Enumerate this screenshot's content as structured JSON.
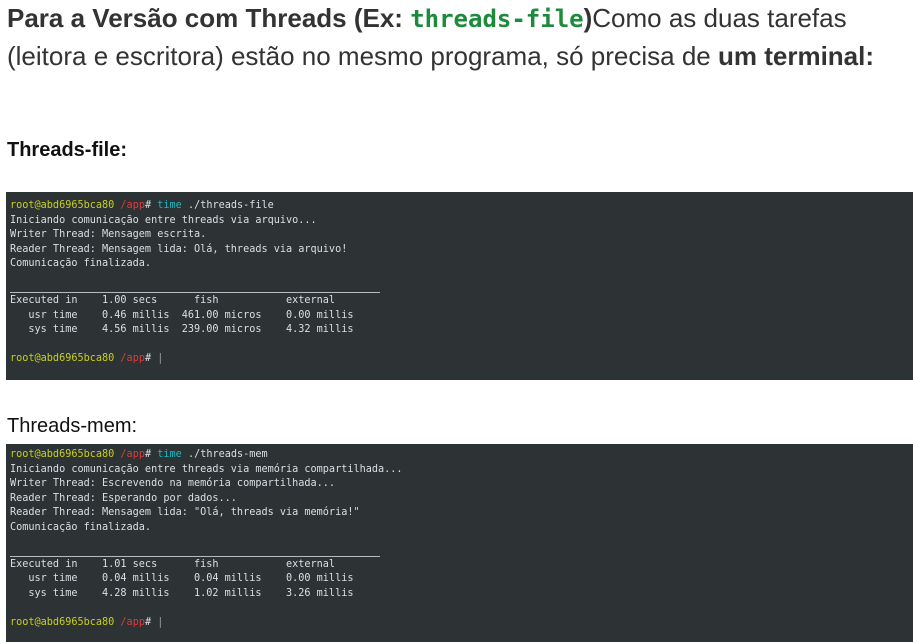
{
  "intro": {
    "bold_prefix": "Para a Versão com Threads (Ex: ",
    "code": "threads-file",
    "bold_close": ")",
    "normal": "Como as duas tarefas (leitora e escritora) estão no mesmo programa, só precisa de ",
    "bold_end": "um terminal:"
  },
  "section_file": {
    "heading": "Threads-file:"
  },
  "section_mem": {
    "heading": "Threads-mem:"
  },
  "prompt": {
    "user_host": "root@abd6965bca80",
    "path": "/app",
    "hash": "#",
    "cmd_time": "time",
    "cursor": "|"
  },
  "term_file": {
    "command_arg": "./threads-file",
    "output": [
      "Iniciando comunicação entre threads via arquivo...",
      "Writer Thread: Mensagem escrita.",
      "Reader Thread: Mensagem lida: Olá, threads via arquivo!",
      "Comunicação finalizada."
    ],
    "timing": [
      "Executed in    1.00 secs      fish           external",
      "   usr time    0.46 millis  461.00 micros    0.00 millis",
      "   sys time    4.56 millis  239.00 micros    4.32 millis"
    ]
  },
  "term_mem": {
    "command_arg": "./threads-mem",
    "output": [
      "Iniciando comunicação entre threads via memória compartilhada...",
      "Writer Thread: Escrevendo na memória compartilhada...",
      "Reader Thread: Esperando por dados...",
      "Reader Thread: Mensagem lida: \"Olá, threads via memória!\"",
      "Comunicação finalizada."
    ],
    "timing": [
      "Executed in    1.01 secs      fish           external",
      "   usr time    0.04 millis    0.04 millis    0.00 millis",
      "   sys time    4.28 millis    1.02 millis    3.26 millis"
    ]
  },
  "colors": {
    "terminal_bg": "#2d3234",
    "prompt_user": "#c8d020",
    "prompt_path": "#e0393c",
    "command": "#21b6c0",
    "code_green": "#1e8a3c"
  }
}
